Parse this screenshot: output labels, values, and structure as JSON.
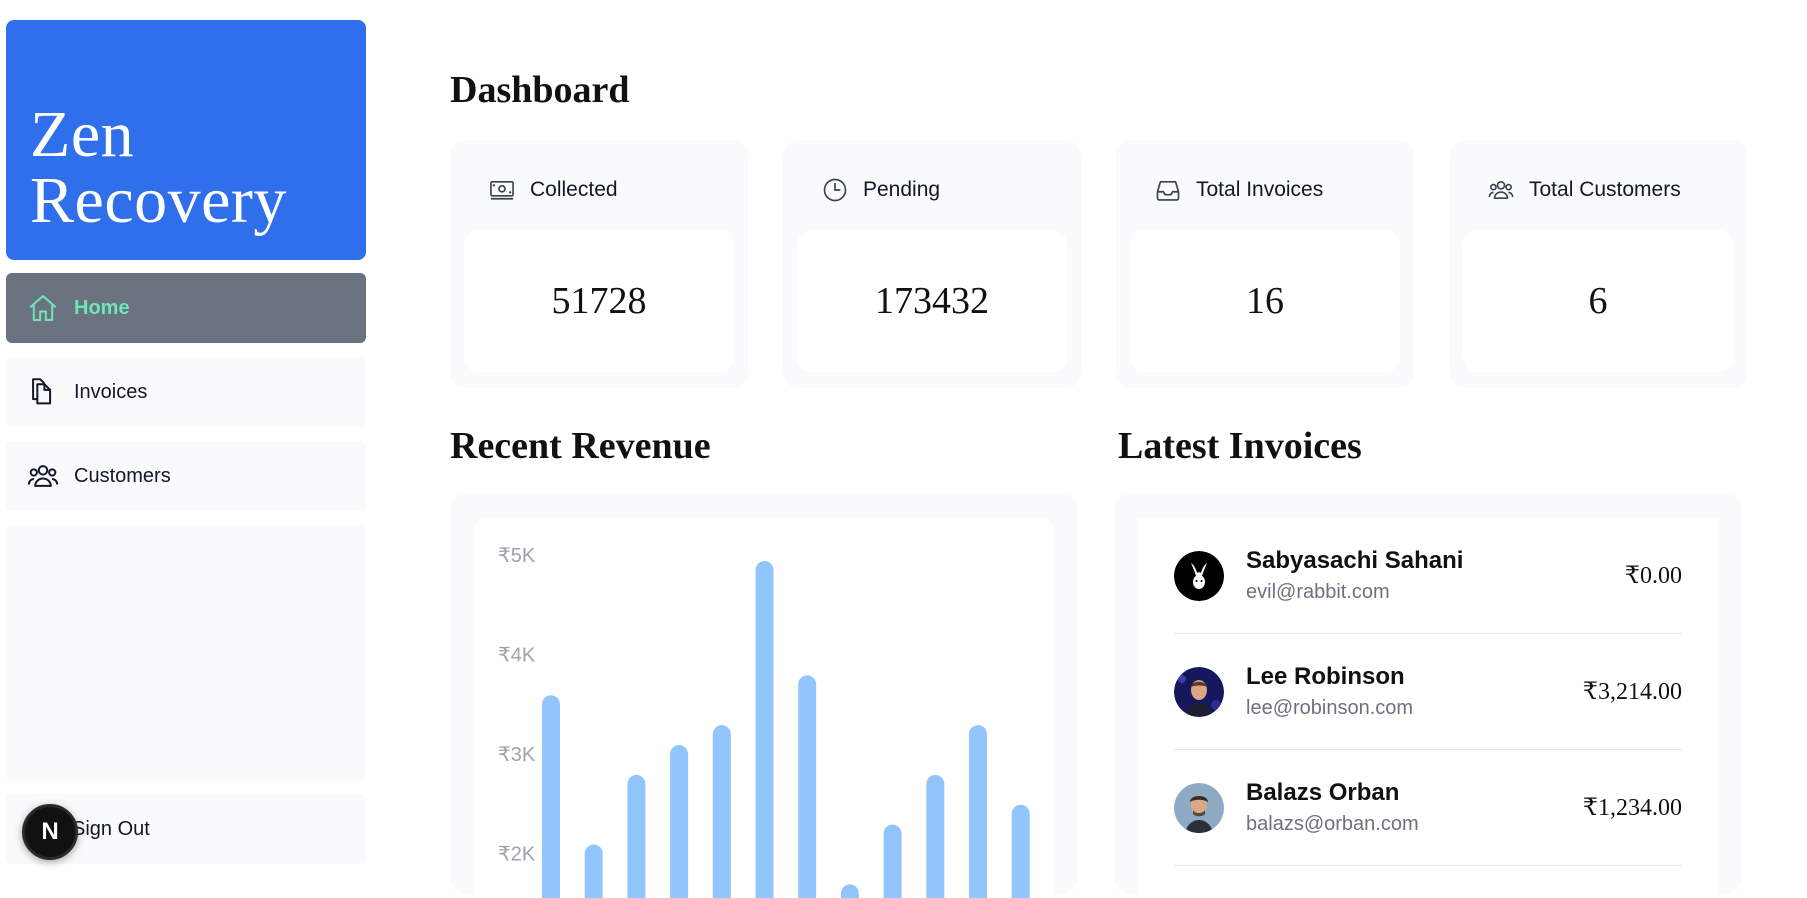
{
  "brand": {
    "line1": "Zen",
    "line2": "Recovery",
    "color": "#2f6feb"
  },
  "nav": {
    "home": {
      "label": "Home",
      "icon": "home-icon"
    },
    "invoices": {
      "label": "Invoices",
      "icon": "documents-icon"
    },
    "customers": {
      "label": "Customers",
      "icon": "users-icon"
    },
    "signout": {
      "label": "Sign Out",
      "icon": "power-icon"
    },
    "active_color": "#6ee7b7"
  },
  "next_badge": {
    "letter": "N"
  },
  "page": {
    "title": "Dashboard"
  },
  "cards": [
    {
      "label": "Collected",
      "value": "51728",
      "icon": "banknotes-icon"
    },
    {
      "label": "Pending",
      "value": "173432",
      "icon": "clock-icon"
    },
    {
      "label": "Total Invoices",
      "value": "16",
      "icon": "inbox-icon"
    },
    {
      "label": "Total Customers",
      "value": "6",
      "icon": "users-icon"
    }
  ],
  "revenue": {
    "title": "Recent Revenue"
  },
  "chart_data": {
    "type": "bar",
    "y_ticks": [
      "₹5K",
      "₹4K",
      "₹3K",
      "₹2K"
    ],
    "ylim": [
      1700,
      5000
    ],
    "values": [
      3600,
      2100,
      2800,
      3100,
      3300,
      4950,
      3800,
      1700,
      2300,
      2800,
      3300,
      2500
    ],
    "bar_color": "#93c5fd"
  },
  "invoices": {
    "title": "Latest Invoices",
    "items": [
      {
        "name": "Sabyasachi Sahani",
        "email": "evil@rabbit.com",
        "amount": "₹0.00",
        "avatar": "rabbit-avatar"
      },
      {
        "name": "Lee Robinson",
        "email": "lee@robinson.com",
        "amount": "₹3,214.00",
        "avatar": "lee-avatar"
      },
      {
        "name": "Balazs Orban",
        "email": "balazs@orban.com",
        "amount": "₹1,234.00",
        "avatar": "balazs-avatar"
      }
    ]
  }
}
